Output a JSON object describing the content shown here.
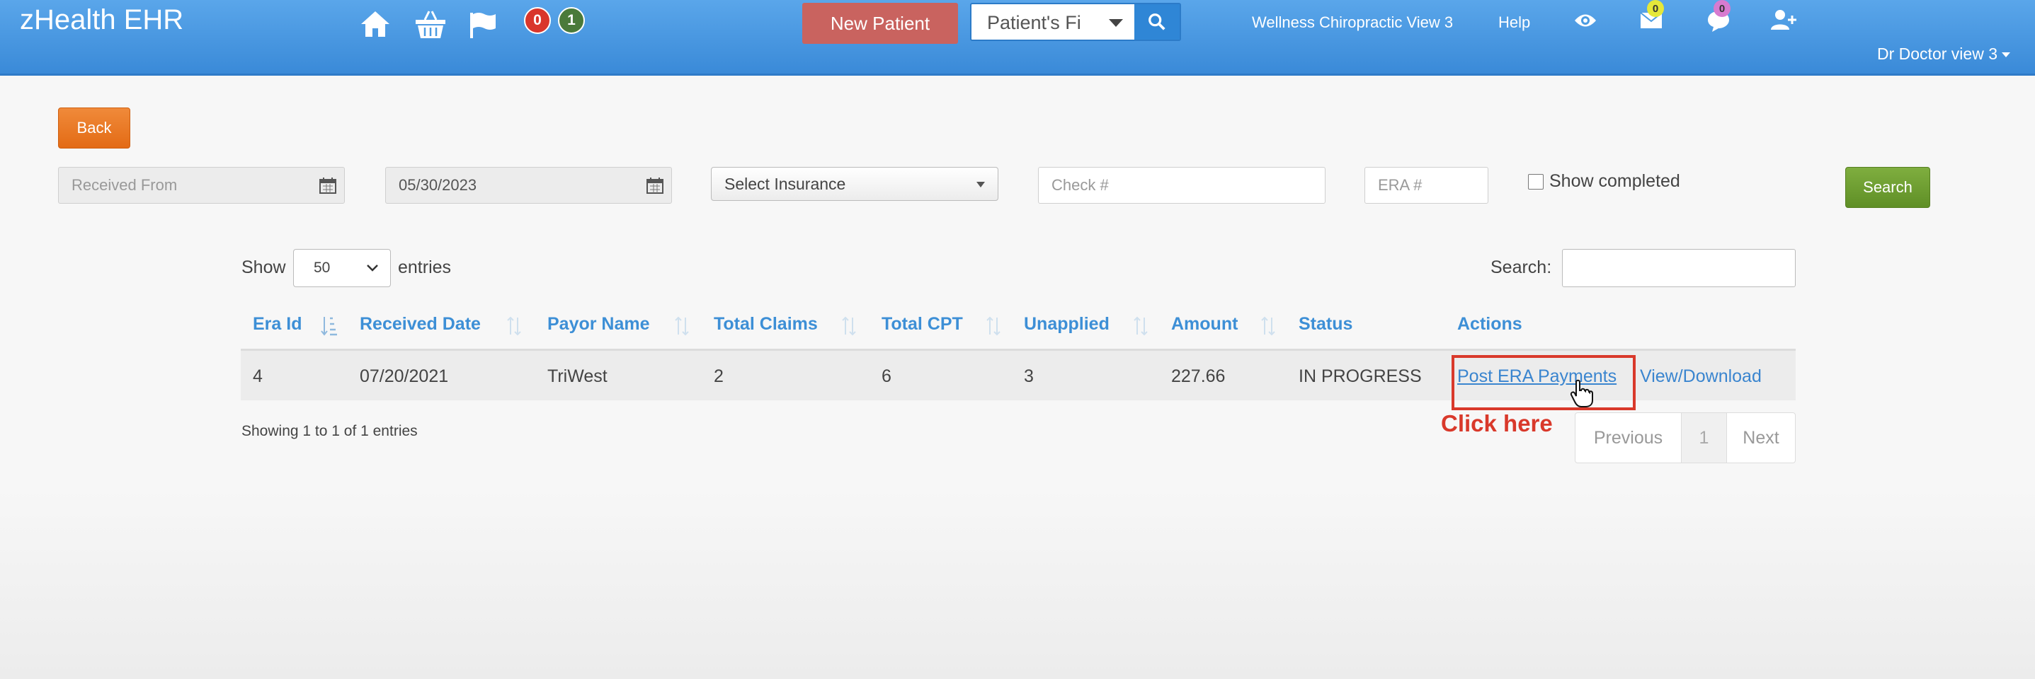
{
  "app": {
    "title": "zHealth EHR"
  },
  "nav": {
    "icons": [
      "home-icon",
      "basket-icon",
      "flag-icon"
    ],
    "red_badge_count": "0",
    "green_badge_count": "1",
    "new_patient_label": "New Patient",
    "patient_search_placeholder": "Patient's Fi",
    "clinic_label": "Wellness Chiropractic View 3",
    "help_label": "Help",
    "mail_count": "0",
    "chat_count": "0",
    "user_label": "Dr Doctor view 3",
    "colors": {
      "navbar": "#4a9be2",
      "red_badge": "#d9362b",
      "green_badge": "#4a7a3a",
      "mail_badge": "#e5e83a",
      "chat_badge": "#d77bd0"
    }
  },
  "filters": {
    "back_label": "Back",
    "received_from_placeholder": "Received From",
    "received_to_value": "05/30/2023",
    "insurance_selected": "Select Insurance",
    "check_placeholder": "Check #",
    "era_placeholder": "ERA #",
    "show_completed_label": "Show completed",
    "show_completed_checked": false,
    "search_label": "Search"
  },
  "table_controls": {
    "show_label": "Show",
    "page_length": "50",
    "entries_label": "entries",
    "search_label": "Search:"
  },
  "table": {
    "columns": [
      "Era Id",
      "Received Date",
      "Payor Name",
      "Total Claims",
      "Total CPT",
      "Unapplied",
      "Amount",
      "Status",
      "Actions"
    ],
    "rows": [
      {
        "era_id": "4",
        "received_date": "07/20/2021",
        "payor_name": "TriWest",
        "total_claims": "2",
        "total_cpt": "6",
        "unapplied": "3",
        "amount": "227.66",
        "status": "IN PROGRESS",
        "action_post": "Post ERA Payments",
        "action_view": "View/Download"
      }
    ]
  },
  "annotation": {
    "label": "Click here",
    "color": "#d9392b"
  },
  "footer": {
    "info": "Showing 1 to 1 of 1 entries",
    "previous_label": "Previous",
    "current_page": "1",
    "next_label": "Next"
  }
}
